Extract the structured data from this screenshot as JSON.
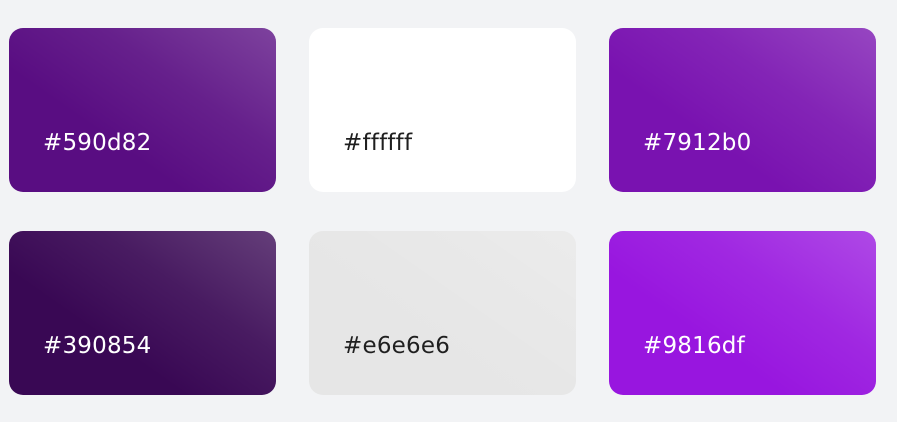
{
  "swatches": [
    {
      "hex": "#590d82",
      "color": "#590d82",
      "text_tone": "light"
    },
    {
      "hex": "#ffffff",
      "color": "#ffffff",
      "text_tone": "dark"
    },
    {
      "hex": "#7912b0",
      "color": "#7912b0",
      "text_tone": "light"
    },
    {
      "hex": "#390854",
      "color": "#390854",
      "text_tone": "light"
    },
    {
      "hex": "#e6e6e6",
      "color": "#e6e6e6",
      "text_tone": "dark"
    },
    {
      "hex": "#9816df",
      "color": "#9816df",
      "text_tone": "light"
    }
  ],
  "labels": {
    "s0": "#590d82",
    "s1": "#ffffff",
    "s2": "#7912b0",
    "s3": "#390854",
    "s4": "#e6e6e6",
    "s5": "#9816df"
  },
  "colors": {
    "page_background": "#f2f3f5",
    "dark_label": "#1f1f1f",
    "light_label": "#ffffff"
  }
}
